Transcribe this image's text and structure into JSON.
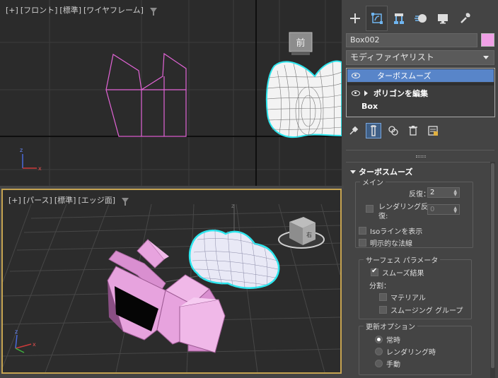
{
  "viewports": {
    "front": {
      "label": {
        "plus": "[+]",
        "view": "[フロント]",
        "mode": "[標準]",
        "shading": "[ワイヤフレーム]"
      },
      "view_cube": "前"
    },
    "perspective": {
      "label": {
        "plus": "[+]",
        "view": "[パース]",
        "mode": "[標準]",
        "shading": "[エッジ面]"
      },
      "view_cube_label": "右"
    }
  },
  "command_panel": {
    "tabs": [
      "create-tab",
      "modify-tab",
      "hierarchy-tab",
      "motion-tab",
      "display-tab",
      "utilities-tab"
    ],
    "active_tab": "modify-tab",
    "object_name": "Box002",
    "object_color": "#f0a0e6",
    "modifier_list": "モディファイヤリスト",
    "stack": [
      {
        "label": "ターボスムーズ",
        "selected": true
      },
      {
        "label": "ポリゴンを編集",
        "selected": false
      },
      {
        "label": "Box",
        "selected": false
      }
    ]
  },
  "turbosmooth": {
    "title": "ターボスムーズ",
    "main": {
      "group": "メイン",
      "iterations_label": "反復：",
      "iterations": "2",
      "render_iters_label_1": "レンダリング反",
      "render_iters_label_2": "復:",
      "render_iters": "0",
      "render_iters_checked": false,
      "isoline_label": "Isoラインを表示",
      "isoline": false,
      "explicit_normals_label": "明示的な法線",
      "explicit_normals": false
    },
    "surface": {
      "group": "サーフェス パラメータ",
      "smooth_result_label": "スムーズ結果",
      "smooth_result": true,
      "separate_label": "分割：",
      "materials_label": "マテリアル",
      "materials": false,
      "smoothing_groups_label": "スムージング グループ",
      "smoothing_groups": false
    },
    "update": {
      "group": "更新オプション",
      "always": "常時",
      "when_rendering": "レンダリング時",
      "manually": "手動",
      "selected": "always"
    }
  }
}
